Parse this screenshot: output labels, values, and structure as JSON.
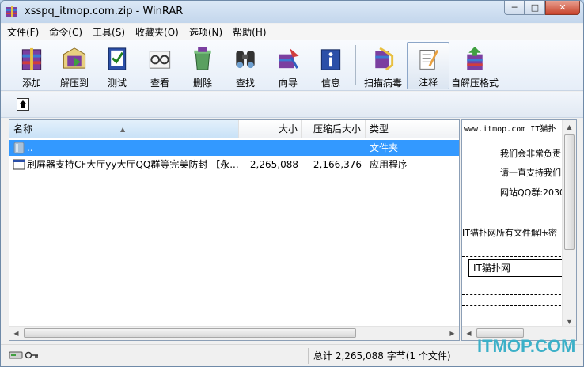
{
  "window": {
    "title": "xsspq_itmop.com.zip - WinRAR",
    "controls": {
      "minimize": "─",
      "maximize": "□",
      "close": "✕"
    }
  },
  "menu": [
    {
      "label": "文件(F)"
    },
    {
      "label": "命令(C)"
    },
    {
      "label": "工具(S)"
    },
    {
      "label": "收藏夹(O)"
    },
    {
      "label": "选项(N)"
    },
    {
      "label": "帮助(H)"
    }
  ],
  "toolbar": {
    "buttons": [
      {
        "label": "添加",
        "icon": "add-archive-icon"
      },
      {
        "label": "解压到",
        "icon": "extract-to-icon"
      },
      {
        "label": "测试",
        "icon": "test-icon"
      },
      {
        "label": "查看",
        "icon": "view-icon"
      },
      {
        "label": "删除",
        "icon": "delete-icon"
      },
      {
        "label": "查找",
        "icon": "find-icon"
      },
      {
        "label": "向导",
        "icon": "wizard-icon"
      },
      {
        "label": "信息",
        "icon": "info-icon"
      },
      {
        "label": "扫描病毒",
        "icon": "virus-scan-icon"
      },
      {
        "label": "注释",
        "icon": "comment-icon"
      },
      {
        "label": "自解压格式",
        "icon": "sfx-icon"
      }
    ]
  },
  "filelist": {
    "columns": {
      "name": "名称",
      "size": "大小",
      "packed": "压缩后大小",
      "type": "类型"
    },
    "rows": [
      {
        "name": "..",
        "size": "",
        "packed": "",
        "type": "文件夹"
      },
      {
        "name": "刷屏器支持CF大厅yy大厅QQ群等完美防封 【永...",
        "size": "2,265,088",
        "packed": "2,166,376",
        "type": "应用程序"
      }
    ]
  },
  "comment": {
    "lines": [
      "www.itmop.com  IT猫扑",
      "我们会非常负责",
      "请一直支持我们",
      "网站QQ群:2030",
      "IT猫扑网所有文件解压密",
      "IT猫扑网"
    ]
  },
  "status": {
    "text": "总计 2,265,088 字节(1 个文件)"
  },
  "watermark": "ITMOP.COM",
  "colors": {
    "selection": "#3399ff",
    "watermark": "#3cb0c8"
  }
}
